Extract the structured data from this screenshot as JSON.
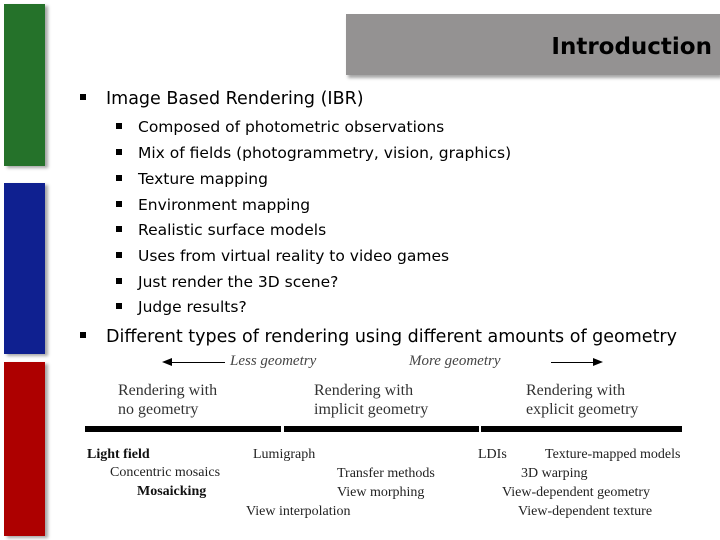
{
  "slide": {
    "title": "Introduction",
    "accent_colors": {
      "green": "#25722a",
      "blue": "#0f2090",
      "red": "#ad0000",
      "title_bg": "#949292"
    },
    "bullets": [
      {
        "text": "Image Based Rendering (IBR)",
        "children": [
          "Composed of photometric observations",
          "Mix of fields (photogrammetry, vision, graphics)",
          "Texture mapping",
          "Environment mapping",
          "Realistic surface models",
          "Uses from virtual reality to video games",
          "Just render the 3D scene?",
          "Judge results?"
        ]
      },
      {
        "text": "Different types of rendering using different amounts of geometry",
        "children": []
      }
    ]
  },
  "diagram": {
    "less_label": "Less geometry",
    "more_label": "More geometry",
    "categories": [
      {
        "line1": "Rendering with",
        "line2": "no geometry"
      },
      {
        "line1": "Rendering with",
        "line2": "implicit geometry"
      },
      {
        "line1": "Rendering with",
        "line2": "explicit geometry"
      }
    ],
    "techniques": {
      "light_field": "Light field",
      "concentric_mosaics": "Concentric mosaics",
      "mosaicking": "Mosaicking",
      "lumigraph": "Lumigraph",
      "transfer_methods": "Transfer methods",
      "view_morphing": "View morphing",
      "view_interpolation": "View interpolation",
      "ldis": "LDIs",
      "texture_mapped_models": "Texture-mapped models",
      "warping_3d": "3D warping",
      "view_dependent_geometry": "View-dependent geometry",
      "view_dependent_texture": "View-dependent texture"
    }
  }
}
